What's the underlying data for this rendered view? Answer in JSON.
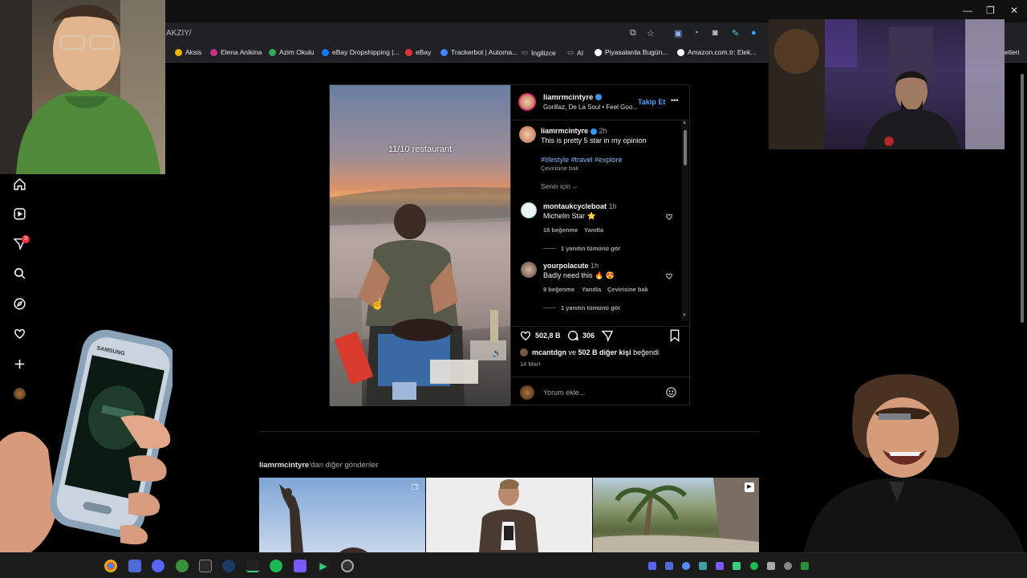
{
  "browser": {
    "url_fragment": "AKZIY/",
    "window_controls": [
      "—",
      "❐",
      "✕"
    ],
    "bookmarks": [
      {
        "label": "Aksis",
        "color": "#f4b400"
      },
      {
        "label": "Elena Anikina",
        "color": "#c13584"
      },
      {
        "label": "Azim Okulu",
        "color": "#34a853"
      },
      {
        "label": "eBay Dropshipping |...",
        "color": "#1877f2"
      },
      {
        "label": "eBay",
        "color": "#e53238"
      },
      {
        "label": "Trackerbot | Automa...",
        "color": "#4285f4"
      },
      {
        "label": "İngilizce",
        "color": "#888888"
      },
      {
        "label": "AI",
        "color": "#888888"
      },
      {
        "label": "Piyasalarda Bugün...",
        "color": "#ffffff"
      },
      {
        "label": "Amazon.com.tr: Elek...",
        "color": "#ffffff"
      },
      {
        "label": "etleri",
        "color": "#888888"
      }
    ]
  },
  "sidebar": {
    "items": [
      {
        "icon": "home-icon"
      },
      {
        "icon": "reels-icon"
      },
      {
        "icon": "direct-messages-icon",
        "badge": "3"
      },
      {
        "icon": "search-icon"
      },
      {
        "icon": "explore-icon"
      },
      {
        "icon": "notifications-heart-icon"
      },
      {
        "icon": "create-plus-icon"
      },
      {
        "icon": "profile-avatar"
      }
    ]
  },
  "post": {
    "video_caption": "11/10 restaurant",
    "author": "liamrmcintyre",
    "music": "Gorillaz, De La Soul • Feel Goo...",
    "follow_label": "Takip Et",
    "more_label": "•••",
    "caption": {
      "username": "liamrmcintyre",
      "time": "2h",
      "text": "This is pretty 5 star in my opinion",
      "hashtags": "#lifestyle #travel #explore",
      "translate": "Çevirisine bak"
    },
    "for_you": "Senin için",
    "comments": [
      {
        "username": "montaukcycleboat",
        "time": "1h",
        "text": "Michelin Star ⭐",
        "likes": "16 beğenme",
        "reply": "Yanıtla",
        "translate": "",
        "view_replies": "1 yanıtın tümünü gör"
      },
      {
        "username": "yourpolacute",
        "time": "1h",
        "text": "Badly need this 🔥 😍",
        "likes": "9 beğenme",
        "reply": "Yanıtla",
        "translate": "Çevirisine bak",
        "view_replies": "1 yanıtın tümünü gör"
      }
    ],
    "like_count": "502,8 B",
    "comment_count": "306",
    "liked_by_user": "mcantdgn",
    "liked_by_middle": " ve ",
    "liked_by_others": "502 B diğer kişi",
    "liked_by_suffix": " beğendi",
    "date": "14 Mart",
    "comment_placeholder": "Yorum ekle..."
  },
  "more_posts": {
    "user": "liamrmcintyre",
    "suffix": "'dan diğer gönderiler"
  },
  "overlays": {
    "phone_brand": "SAMSUNG"
  },
  "colors": {
    "accent_blue": "#4aa3ff",
    "notification_red": "#ff3040",
    "verified_blue": "#3897f0"
  }
}
